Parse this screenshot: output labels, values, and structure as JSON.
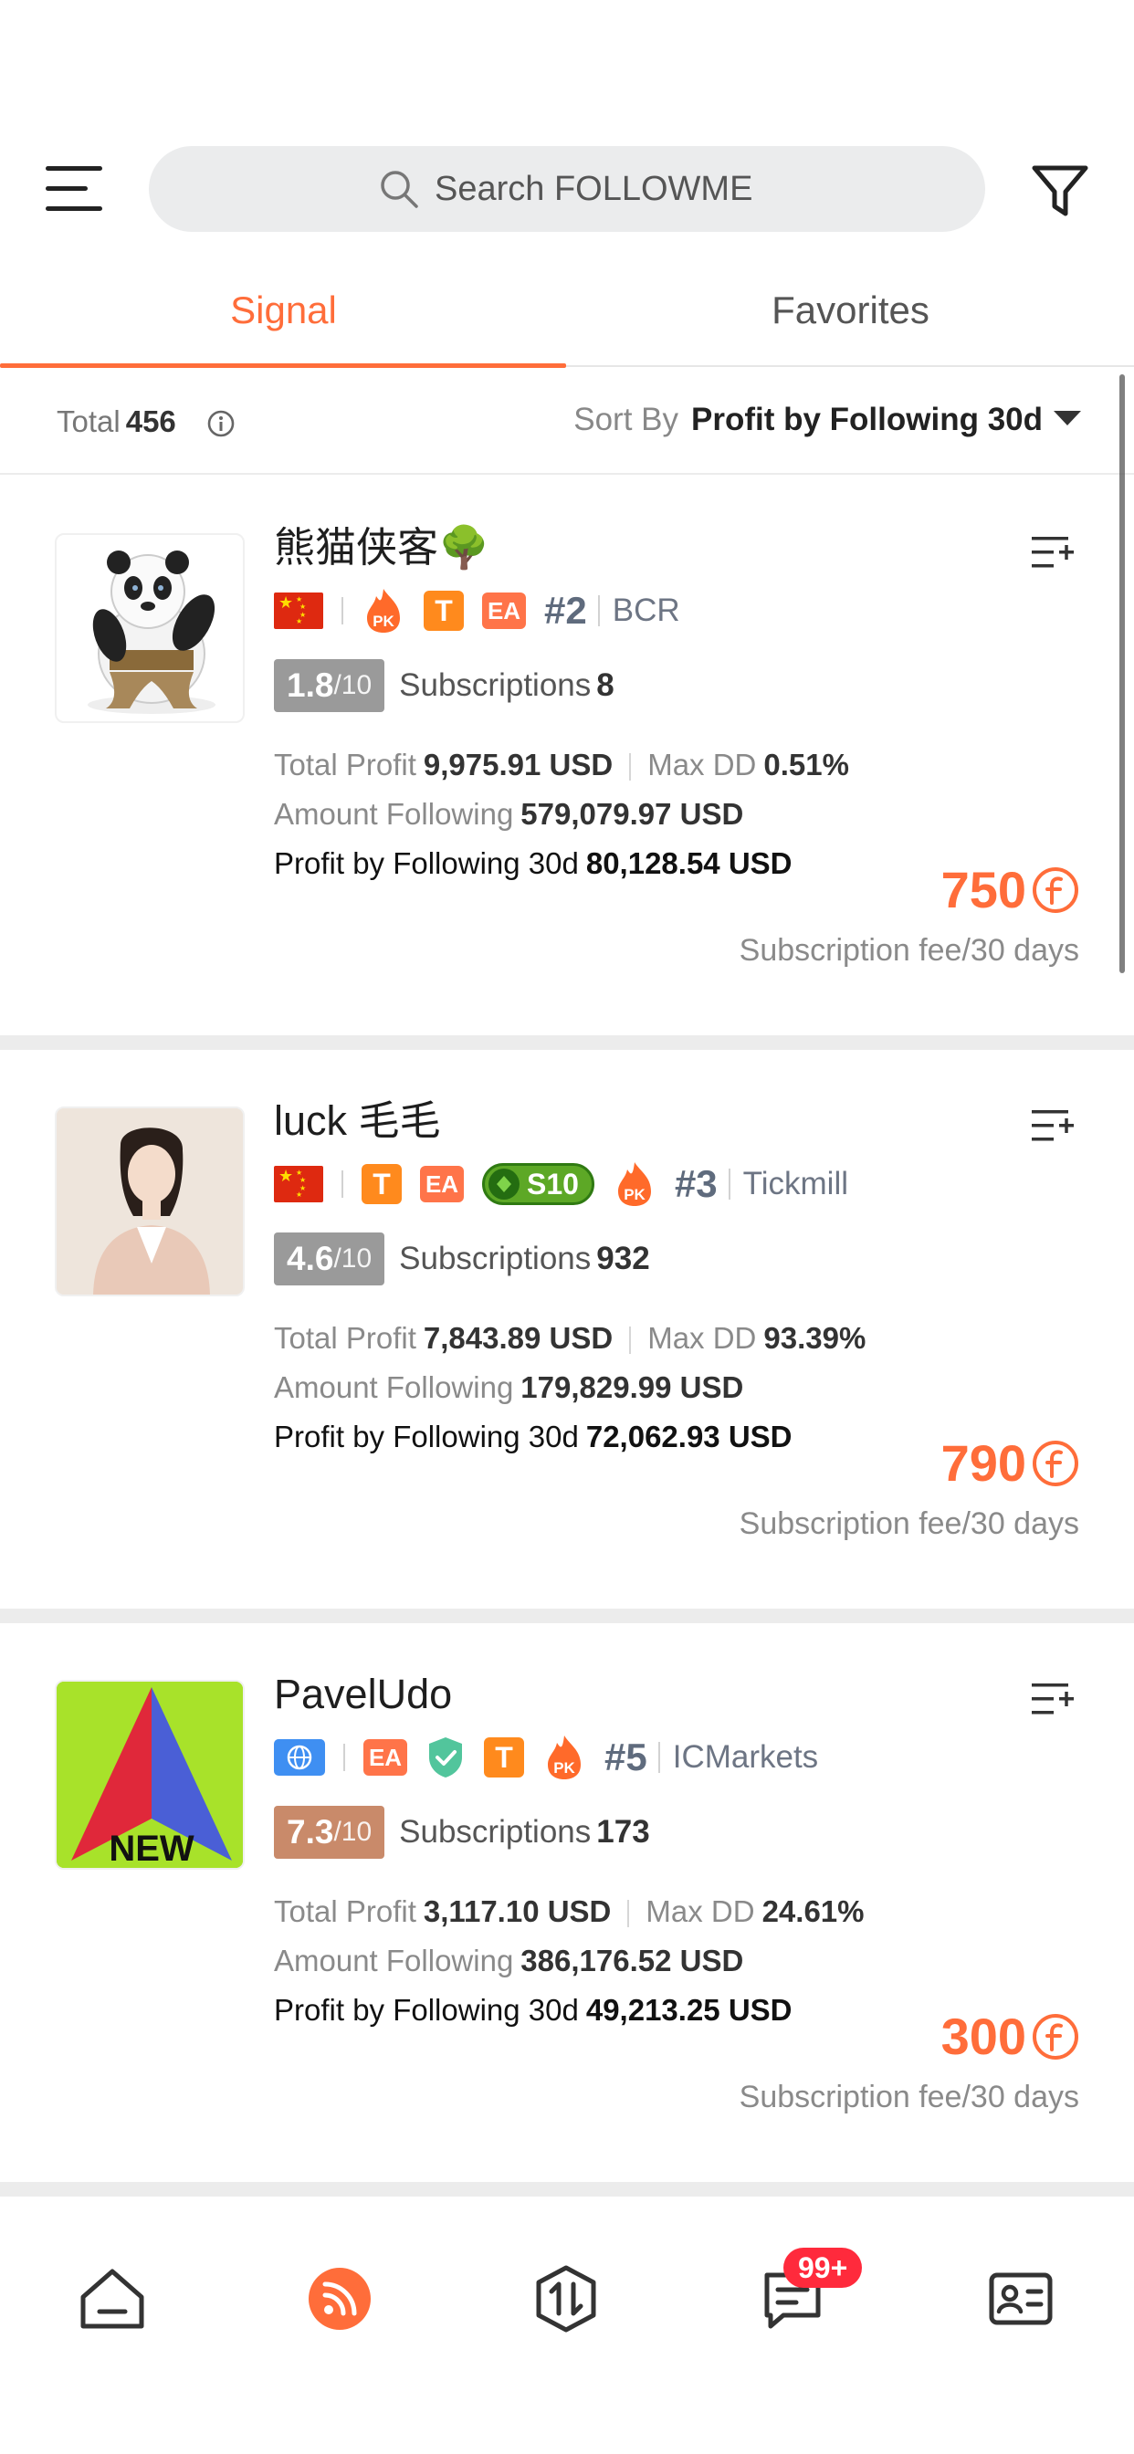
{
  "search": {
    "placeholder": "Search FOLLOWME"
  },
  "tabs": [
    {
      "label": "Signal",
      "active": true
    },
    {
      "label": "Favorites",
      "active": false
    }
  ],
  "summary": {
    "total_label": "Total",
    "total_value": "456",
    "sort_label": "Sort By",
    "sort_value": "Profit by Following 30d"
  },
  "labels": {
    "subscriptions": "Subscriptions",
    "total_profit": "Total Profit",
    "max_dd": "Max DD",
    "amount_following": "Amount Following",
    "profit_following_30d": "Profit by Following 30d",
    "fee_period": "Subscription fee/30 days",
    "score_den": "/10"
  },
  "signals": [
    {
      "name": "熊猫侠客🌳",
      "rank": "#2",
      "broker": "BCR",
      "score": "1.8",
      "score_color": "#9a9a9a",
      "subscriptions": "8",
      "total_profit": "9,975.91 USD",
      "max_dd": "0.51%",
      "amount_following": "579,079.97 USD",
      "profit_following_30d": "80,128.54 USD",
      "fee": "750",
      "badges": [
        "china-flag",
        "pk-fire",
        "trader-t",
        "ea"
      ]
    },
    {
      "name": "luck 毛毛",
      "rank": "#3",
      "broker": "Tickmill",
      "score": "4.6",
      "score_color": "#9a9a9a",
      "subscriptions": "932",
      "total_profit": "7,843.89 USD",
      "max_dd": "93.39%",
      "amount_following": "179,829.99 USD",
      "profit_following_30d": "72,062.93 USD",
      "fee": "790",
      "s10_label": "S10",
      "badges": [
        "china-flag",
        "trader-t",
        "ea",
        "s10",
        "pk-fire"
      ]
    },
    {
      "name": "PavelUdo",
      "rank": "#5",
      "broker": "ICMarkets",
      "score": "7.3",
      "score_color": "#c98a6a",
      "subscriptions": "173",
      "total_profit": "3,117.10 USD",
      "max_dd": "24.61%",
      "amount_following": "386,176.52 USD",
      "profit_following_30d": "49,213.25 USD",
      "fee": "300",
      "avatar_text": "NEW",
      "badges": [
        "globe",
        "ea",
        "verified-shield",
        "trader-t",
        "pk-fire"
      ]
    }
  ],
  "badge_text": {
    "t": "T",
    "ea": "EA"
  },
  "nav": {
    "items": [
      "home-icon",
      "signal-feed-icon",
      "trade-icon",
      "messages-icon",
      "profile-card-icon"
    ],
    "active": "signal-feed-icon",
    "messages_badge": "99+"
  },
  "colors": {
    "accent": "#ff6d3a",
    "badge_red": "#ff2a3c"
  }
}
